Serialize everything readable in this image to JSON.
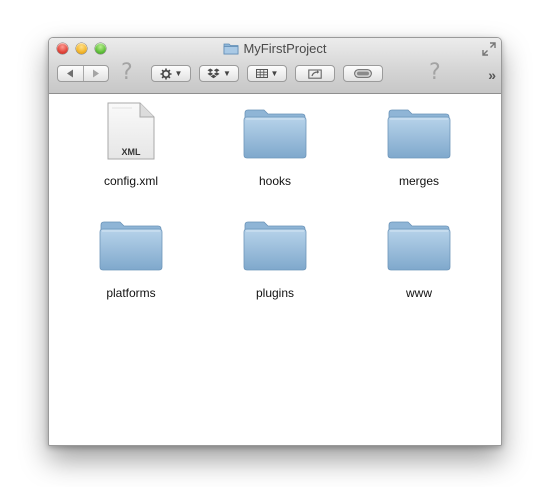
{
  "window": {
    "title": "MyFirstProject"
  },
  "toolbar": {
    "back_icon": "back-arrow-icon",
    "forward_icon": "forward-arrow-icon",
    "help_glyph": "?",
    "action_icon": "gear-icon",
    "dropbox_icon": "dropbox-icon",
    "view_icon": "view-grid-icon",
    "share_icon": "share-icon",
    "toggle_icon": "toggle-pill-icon",
    "help_glyph_right": "?",
    "overflow_glyph": "»"
  },
  "items": [
    {
      "name": "config.xml",
      "kind": "file",
      "badge": "XML"
    },
    {
      "name": "hooks",
      "kind": "folder"
    },
    {
      "name": "merges",
      "kind": "folder"
    },
    {
      "name": "platforms",
      "kind": "folder"
    },
    {
      "name": "plugins",
      "kind": "folder"
    },
    {
      "name": "www",
      "kind": "folder"
    }
  ],
  "colors": {
    "folder_top": "#b7d3ea",
    "folder_bottom": "#7fa8cc",
    "titlebar_top": "#ececec",
    "titlebar_bottom": "#c7c7c7"
  }
}
